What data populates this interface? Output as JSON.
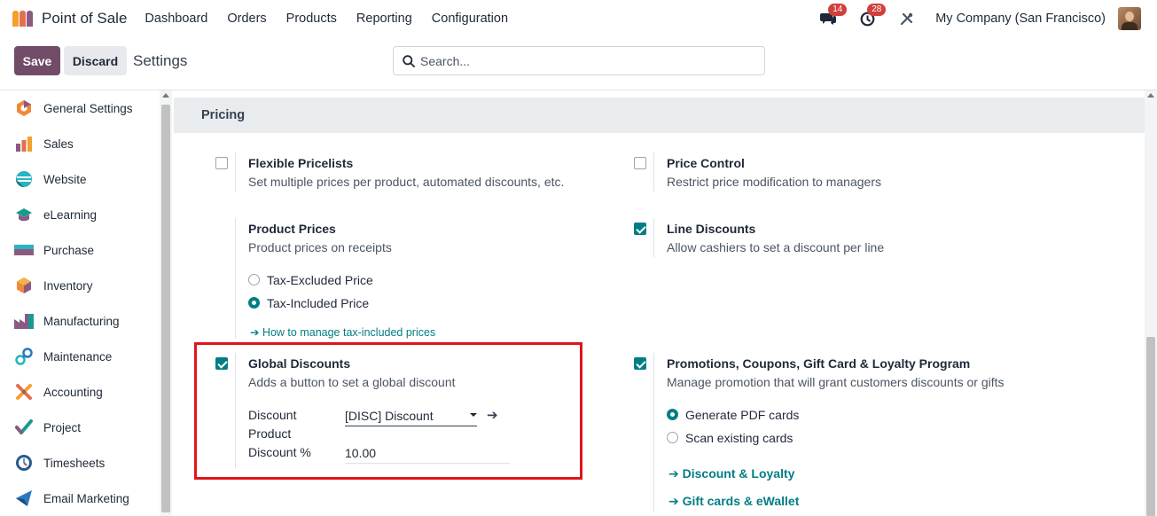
{
  "app": {
    "title": "Point of Sale",
    "menu": [
      "Dashboard",
      "Orders",
      "Products",
      "Reporting",
      "Configuration"
    ],
    "messages_count": "14",
    "activities_count": "28",
    "company": "My Company (San Francisco)"
  },
  "control": {
    "save_label": "Save",
    "discard_label": "Discard",
    "page_title": "Settings",
    "search_placeholder": "Search..."
  },
  "sidebar": {
    "items": [
      {
        "label": "General Settings",
        "icon": "general-settings-icon"
      },
      {
        "label": "Sales",
        "icon": "sales-icon"
      },
      {
        "label": "Website",
        "icon": "website-icon"
      },
      {
        "label": "eLearning",
        "icon": "elearning-icon"
      },
      {
        "label": "Purchase",
        "icon": "purchase-icon"
      },
      {
        "label": "Inventory",
        "icon": "inventory-icon"
      },
      {
        "label": "Manufacturing",
        "icon": "manufacturing-icon"
      },
      {
        "label": "Maintenance",
        "icon": "maintenance-icon"
      },
      {
        "label": "Accounting",
        "icon": "accounting-icon"
      },
      {
        "label": "Project",
        "icon": "project-icon"
      },
      {
        "label": "Timesheets",
        "icon": "timesheets-icon"
      },
      {
        "label": "Email Marketing",
        "icon": "email-marketing-icon"
      }
    ]
  },
  "pricing": {
    "section_title": "Pricing",
    "flexible_pricelists": {
      "title": "Flexible Pricelists",
      "desc": "Set multiple prices per product, automated discounts, etc.",
      "checked": false
    },
    "price_control": {
      "title": "Price Control",
      "desc": "Restrict price modification to managers",
      "checked": false
    },
    "product_prices": {
      "title": "Product Prices",
      "desc": "Product prices on receipts",
      "options": [
        "Tax-Excluded Price",
        "Tax-Included Price"
      ],
      "selected": "Tax-Included Price",
      "link": "How to manage tax-included prices"
    },
    "line_discounts": {
      "title": "Line Discounts",
      "desc": "Allow cashiers to set a discount per line",
      "checked": true
    },
    "global_discounts": {
      "title": "Global Discounts",
      "desc": "Adds a button to set a global discount",
      "checked": true,
      "discount_product_label": "Discount Product",
      "discount_product_value": "[DISC] Discount",
      "discount_percent_label": "Discount %",
      "discount_percent_value": "10.00"
    },
    "promotions": {
      "title": "Promotions, Coupons, Gift Card & Loyalty Program",
      "desc": "Manage promotion that will grant customers discounts or gifts",
      "checked": true,
      "options": [
        "Generate PDF cards",
        "Scan existing cards"
      ],
      "selected": "Generate PDF cards",
      "links": [
        "Discount & Loyalty",
        "Gift cards & eWallet"
      ]
    }
  },
  "colors": {
    "accent": "#017e84",
    "brand": "#714b67",
    "highlight": "#e0141b"
  }
}
